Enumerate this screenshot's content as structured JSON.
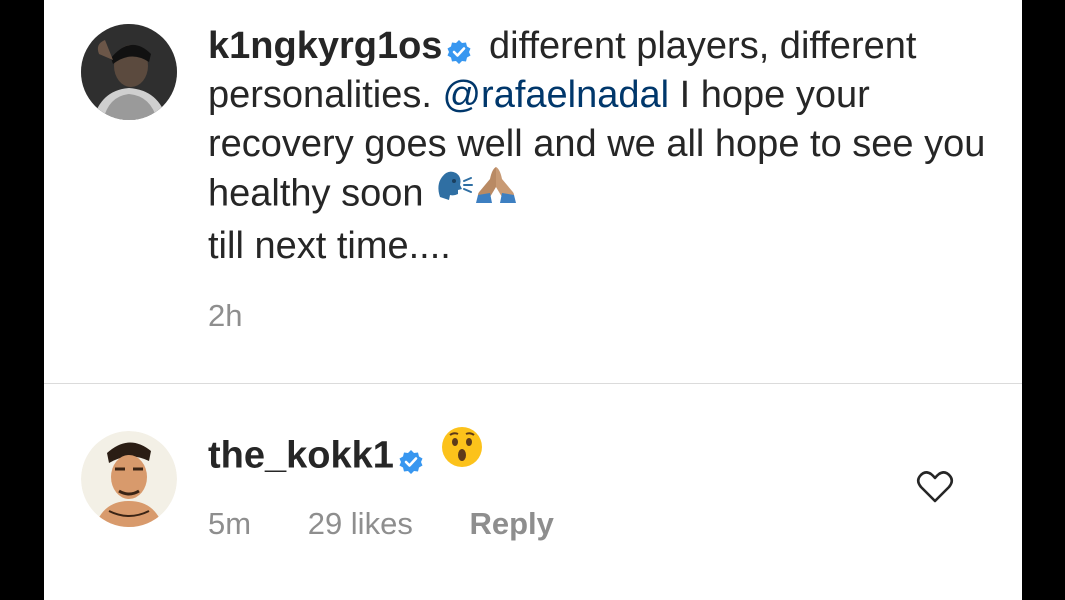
{
  "comments": [
    {
      "username": "k1ngkyrg1os",
      "text_before": "different players, different personalities.",
      "mention": "@rafaelnadal",
      "text_after": "I hope your recovery goes well and we all hope to see you healthy soon",
      "text_end": "till next time....",
      "emojis": [
        "speaking-head-icon",
        "folded-hands-icon"
      ],
      "time": "2h",
      "verified": true
    },
    {
      "username": "the_kokk1",
      "emojis": [
        "astonished-face-icon"
      ],
      "time": "5m",
      "likes": "29 likes",
      "reply_label": "Reply",
      "verified": true,
      "like_icon": "heart-outline-icon"
    }
  ],
  "colors": {
    "text": "#262626",
    "secondary": "#8e8e8e",
    "mention": "#00376b",
    "verified": "#3897f0"
  }
}
